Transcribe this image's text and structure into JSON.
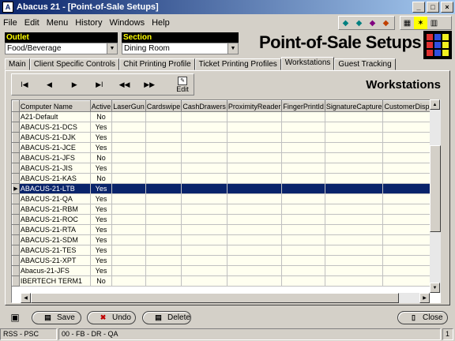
{
  "window": {
    "title": "Abacus 21 - [Point-of-Sale Setups]"
  },
  "menu": [
    "File",
    "Edit",
    "Menu",
    "History",
    "Windows",
    "Help"
  ],
  "outlet": {
    "label": "Outlet",
    "value": "Food/Beverage"
  },
  "section": {
    "label": "Section",
    "value": "Dining Room"
  },
  "page_title": "Point-of-Sale Setups",
  "tabs": [
    {
      "label": "Main"
    },
    {
      "label": "Client Specific Controls"
    },
    {
      "label": "Chit Printing Profile"
    },
    {
      "label": "Ticket Printing Profiles"
    },
    {
      "label": "Workstations",
      "active": true
    },
    {
      "label": "Guest Tracking"
    }
  ],
  "nav": {
    "first": "I◀",
    "prev": "◀",
    "next": "▶",
    "last": "▶I",
    "rewind": "◀◀",
    "ffwd": "▶▶",
    "edit": "Edit"
  },
  "section_title": "Workstations",
  "grid": {
    "columns": [
      "Computer Name",
      "Active",
      "LaserGun",
      "Cardswipe",
      "CashDrawers",
      "ProximityReader",
      "FingerPrintId",
      "SignatureCapture",
      "CustomerDisplay"
    ],
    "rows": [
      {
        "name": "A21-Default",
        "active": "No"
      },
      {
        "name": "ABACUS-21-DCS",
        "active": "Yes"
      },
      {
        "name": "ABACUS-21-DJK",
        "active": "Yes"
      },
      {
        "name": "ABACUS-21-JCE",
        "active": "Yes"
      },
      {
        "name": "ABACUS-21-JFS",
        "active": "No"
      },
      {
        "name": "ABACUS-21-JIS",
        "active": "Yes"
      },
      {
        "name": "ABACUS-21-KAS",
        "active": "No"
      },
      {
        "name": "ABACUS-21-LTB",
        "active": "Yes",
        "selected": true
      },
      {
        "name": "ABACUS-21-QA",
        "active": "Yes"
      },
      {
        "name": "ABACUS-21-RBM",
        "active": "Yes"
      },
      {
        "name": "ABACUS-21-ROC",
        "active": "Yes"
      },
      {
        "name": "ABACUS-21-RTA",
        "active": "Yes"
      },
      {
        "name": "ABACUS-21-SDM",
        "active": "Yes"
      },
      {
        "name": "ABACUS-21-TES",
        "active": "Yes"
      },
      {
        "name": "ABACUS-21-XPT",
        "active": "Yes"
      },
      {
        "name": "Abacus-21-JFS",
        "active": "Yes"
      },
      {
        "name": "IBERTECH TERM1",
        "active": "No"
      }
    ]
  },
  "buttons": {
    "save": "Save",
    "undo": "Undo",
    "delete": "Delete",
    "close": "Close"
  },
  "status": {
    "left": "RSS - PSC",
    "middle": "00 - FB - DR - QA",
    "right": "1"
  }
}
